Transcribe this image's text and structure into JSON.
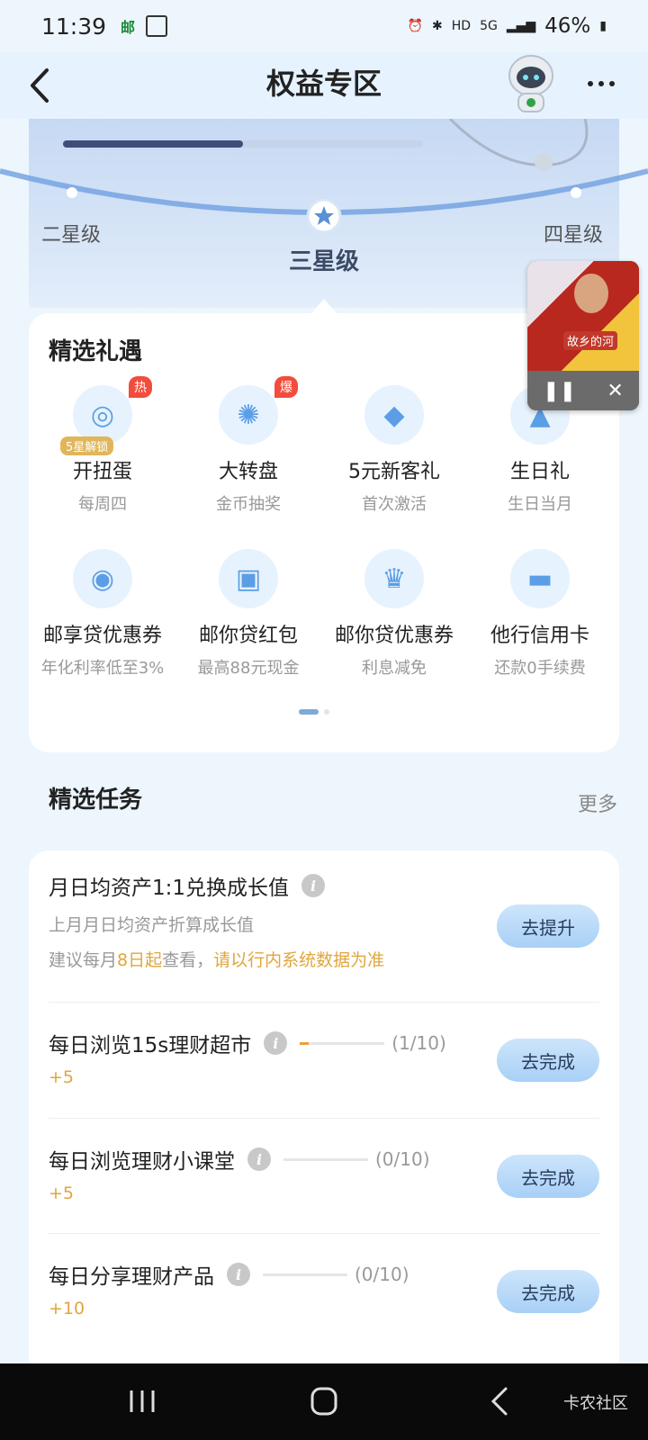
{
  "status_bar": {
    "time": "11:39",
    "battery": "46%",
    "hd": "HD",
    "net": "5G"
  },
  "header": {
    "title": "权益专区"
  },
  "levels": {
    "left": "二星级",
    "center": "三星级",
    "right": "四星级",
    "progress": 0.5
  },
  "gift_section": {
    "title": "精选礼遇",
    "items": [
      {
        "label": "开扭蛋",
        "sub": "每周四",
        "badge": "热",
        "lock": "5星解锁",
        "icon": "capsule-icon"
      },
      {
        "label": "大转盘",
        "sub": "金币抽奖",
        "badge": "爆",
        "lock": "",
        "icon": "wheel-icon"
      },
      {
        "label": "5元新客礼",
        "sub": "首次激活",
        "badge": "",
        "lock": "",
        "icon": "shopping-bag-icon"
      },
      {
        "label": "生日礼",
        "sub": "生日当月",
        "badge": "",
        "lock": "",
        "icon": "cake-icon"
      },
      {
        "label": "邮享贷优惠券",
        "sub": "年化利率低至3%",
        "badge": "",
        "lock": "",
        "icon": "loan-icon"
      },
      {
        "label": "邮你贷红包",
        "sub": "最高88元现金",
        "badge": "",
        "lock": "",
        "icon": "red-packet-icon"
      },
      {
        "label": "邮你贷优惠券",
        "sub": "利息减免",
        "badge": "",
        "lock": "",
        "icon": "crown-icon"
      },
      {
        "label": "他行信用卡",
        "sub": "还款0手续费",
        "badge": "",
        "lock": "",
        "icon": "card-icon"
      }
    ]
  },
  "mini_player": {
    "text": "故乡的河"
  },
  "tasks_section": {
    "title": "精选任务",
    "more": "更多",
    "tasks": [
      {
        "title": "月日均资产1:1兑换成长值",
        "desc": "上月月日均资产折算成长值",
        "note_prefix": "建议每月",
        "note_highlight1": "8日起",
        "note_mid": "查看，",
        "note_highlight2": "请以行内系统数据为准",
        "button": "去提升"
      },
      {
        "title": "每日浏览15s理财超市",
        "progress_text": "(1/10)",
        "progress": 0.1,
        "reward": "+5",
        "button": "去完成"
      },
      {
        "title": "每日浏览理财小课堂",
        "progress_text": "(0/10)",
        "progress": 0,
        "reward": "+5",
        "button": "去完成"
      },
      {
        "title": "每日分享理财产品",
        "progress_text": "(0/10)",
        "progress": 0,
        "reward": "+10",
        "button": "去完成"
      }
    ]
  },
  "watermark": "卡农社区",
  "colors": {
    "accent": "#a8d0f6",
    "reward": "#e0a63c",
    "badge": "#f24d3c"
  }
}
